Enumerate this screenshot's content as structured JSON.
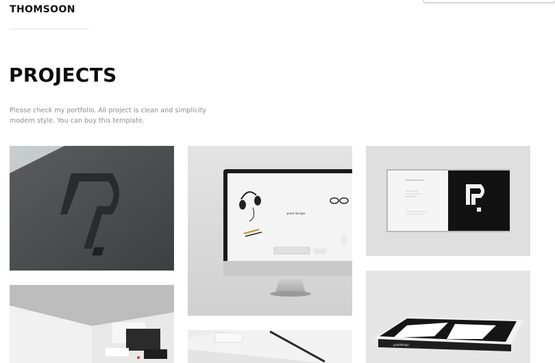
{
  "brand": {
    "name": "THOMSOON"
  },
  "header": {
    "title": "PROJECTS",
    "description": "Please check my portfolio. All project is clean and simplicity modern style. You can buy this template."
  },
  "projects": [
    {
      "image_icon": "embossed-logo-card"
    },
    {
      "image_icon": "monitor-mockup"
    },
    {
      "image_icon": "open-book-mockup"
    },
    {
      "image_icon": "brochure-stationery"
    },
    {
      "image_icon": "desk-stationery"
    },
    {
      "image_icon": "closed-book-mockup"
    }
  ],
  "mockup_text": {
    "monitor_brand": "pixel design",
    "book_brand": "pixeldesign"
  },
  "colors": {
    "title": "#0d0d0d",
    "description": "#8c8c8c",
    "card_gray": "#d9d9d9",
    "dark": "#1a1a1a"
  }
}
